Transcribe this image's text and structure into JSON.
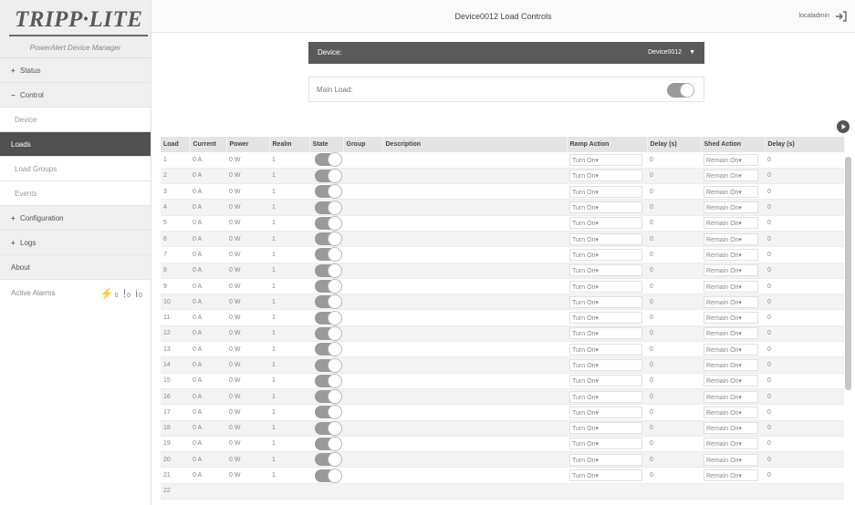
{
  "header": {
    "title": "Device0012 Load Controls",
    "user": "localadmin",
    "logout_icon": "logout-icon"
  },
  "sidebar": {
    "logo": "TRIPP·LITE",
    "logo_sub": "PowerAlert Device Manager",
    "items": [
      {
        "sign": "+",
        "label": "Status",
        "style": "grey"
      },
      {
        "sign": "−",
        "label": "Control",
        "style": "grey"
      },
      {
        "sign": "",
        "label": "Device",
        "style": "sub"
      },
      {
        "sign": "",
        "label": "Loads",
        "style": "active"
      },
      {
        "sign": "",
        "label": "Load Groups",
        "style": "sub"
      },
      {
        "sign": "",
        "label": "Events",
        "style": "sub"
      },
      {
        "sign": "+",
        "label": "Configuration",
        "style": "grey"
      },
      {
        "sign": "+",
        "label": "Logs",
        "style": "grey"
      },
      {
        "sign": "",
        "label": "About",
        "style": "grey"
      }
    ],
    "active_alarms_label": "Active Alarms",
    "alarm_counts": {
      "critical": "0",
      "warning": "0",
      "info": "0"
    }
  },
  "device": {
    "label": "Device:",
    "selected": "Device0012"
  },
  "main_load": {
    "label": "Main Load:",
    "state": "on"
  },
  "table": {
    "headers": [
      "Load",
      "Current",
      "Power",
      "Realm",
      "State",
      "Group",
      "Description",
      "Ramp Action",
      "Delay (s)",
      "Shed Action",
      "Delay (s)"
    ],
    "rows": [
      {
        "load": "1",
        "current": "0 A",
        "power": "0 W",
        "realm": "1",
        "ramp": "Turn On",
        "ramp_delay": "0",
        "shed": "Remain On",
        "shed_delay": "0"
      },
      {
        "load": "2",
        "current": "0 A",
        "power": "0 W",
        "realm": "1",
        "ramp": "Turn On",
        "ramp_delay": "0",
        "shed": "Remain On",
        "shed_delay": "0"
      },
      {
        "load": "3",
        "current": "0 A",
        "power": "0 W",
        "realm": "1",
        "ramp": "Turn On",
        "ramp_delay": "0",
        "shed": "Remain On",
        "shed_delay": "0"
      },
      {
        "load": "4",
        "current": "0 A",
        "power": "0 W",
        "realm": "1",
        "ramp": "Turn On",
        "ramp_delay": "0",
        "shed": "Remain On",
        "shed_delay": "0"
      },
      {
        "load": "5",
        "current": "0 A",
        "power": "0 W",
        "realm": "1",
        "ramp": "Turn On",
        "ramp_delay": "0",
        "shed": "Remain On",
        "shed_delay": "0"
      },
      {
        "load": "6",
        "current": "0 A",
        "power": "0 W",
        "realm": "1",
        "ramp": "Turn On",
        "ramp_delay": "0",
        "shed": "Remain On",
        "shed_delay": "0"
      },
      {
        "load": "7",
        "current": "0 A",
        "power": "0 W",
        "realm": "1",
        "ramp": "Turn On",
        "ramp_delay": "0",
        "shed": "Remain On",
        "shed_delay": "0"
      },
      {
        "load": "8",
        "current": "0 A",
        "power": "0 W",
        "realm": "1",
        "ramp": "Turn On",
        "ramp_delay": "0",
        "shed": "Remain On",
        "shed_delay": "0"
      },
      {
        "load": "9",
        "current": "0 A",
        "power": "0 W",
        "realm": "1",
        "ramp": "Turn On",
        "ramp_delay": "0",
        "shed": "Remain On",
        "shed_delay": "0"
      },
      {
        "load": "10",
        "current": "0 A",
        "power": "0 W",
        "realm": "1",
        "ramp": "Turn On",
        "ramp_delay": "0",
        "shed": "Remain On",
        "shed_delay": "0"
      },
      {
        "load": "11",
        "current": "0 A",
        "power": "0 W",
        "realm": "1",
        "ramp": "Turn On",
        "ramp_delay": "0",
        "shed": "Remain On",
        "shed_delay": "0"
      },
      {
        "load": "12",
        "current": "0 A",
        "power": "0 W",
        "realm": "1",
        "ramp": "Turn On",
        "ramp_delay": "0",
        "shed": "Remain On",
        "shed_delay": "0"
      },
      {
        "load": "13",
        "current": "0 A",
        "power": "0 W",
        "realm": "1",
        "ramp": "Turn On",
        "ramp_delay": "0",
        "shed": "Remain On",
        "shed_delay": "0"
      },
      {
        "load": "14",
        "current": "0 A",
        "power": "0 W",
        "realm": "1",
        "ramp": "Turn On",
        "ramp_delay": "0",
        "shed": "Remain On",
        "shed_delay": "0"
      },
      {
        "load": "15",
        "current": "0 A",
        "power": "0 W",
        "realm": "1",
        "ramp": "Turn On",
        "ramp_delay": "0",
        "shed": "Remain On",
        "shed_delay": "0"
      },
      {
        "load": "16",
        "current": "0 A",
        "power": "0 W",
        "realm": "1",
        "ramp": "Turn On",
        "ramp_delay": "0",
        "shed": "Remain On",
        "shed_delay": "0"
      },
      {
        "load": "17",
        "current": "0 A",
        "power": "0 W",
        "realm": "1",
        "ramp": "Turn On",
        "ramp_delay": "0",
        "shed": "Remain On",
        "shed_delay": "0"
      },
      {
        "load": "18",
        "current": "0 A",
        "power": "0 W",
        "realm": "1",
        "ramp": "Turn On",
        "ramp_delay": "0",
        "shed": "Remain On",
        "shed_delay": "0"
      },
      {
        "load": "19",
        "current": "0 A",
        "power": "0 W",
        "realm": "1",
        "ramp": "Turn On",
        "ramp_delay": "0",
        "shed": "Remain On",
        "shed_delay": "0"
      },
      {
        "load": "20",
        "current": "0 A",
        "power": "0 W",
        "realm": "1",
        "ramp": "Turn On",
        "ramp_delay": "0",
        "shed": "Remain On",
        "shed_delay": "0"
      },
      {
        "load": "21",
        "current": "0 A",
        "power": "0 W",
        "realm": "1",
        "ramp": "Turn On",
        "ramp_delay": "0",
        "shed": "Remain On",
        "shed_delay": "0"
      },
      {
        "load": "22",
        "current": "",
        "power": "",
        "realm": "",
        "ramp": "",
        "ramp_delay": "",
        "shed": "",
        "shed_delay": ""
      }
    ]
  },
  "colors": {
    "active_nav": "#505050",
    "device_bar": "#5a5a5a",
    "toggle_on": "#9a9a9a"
  }
}
